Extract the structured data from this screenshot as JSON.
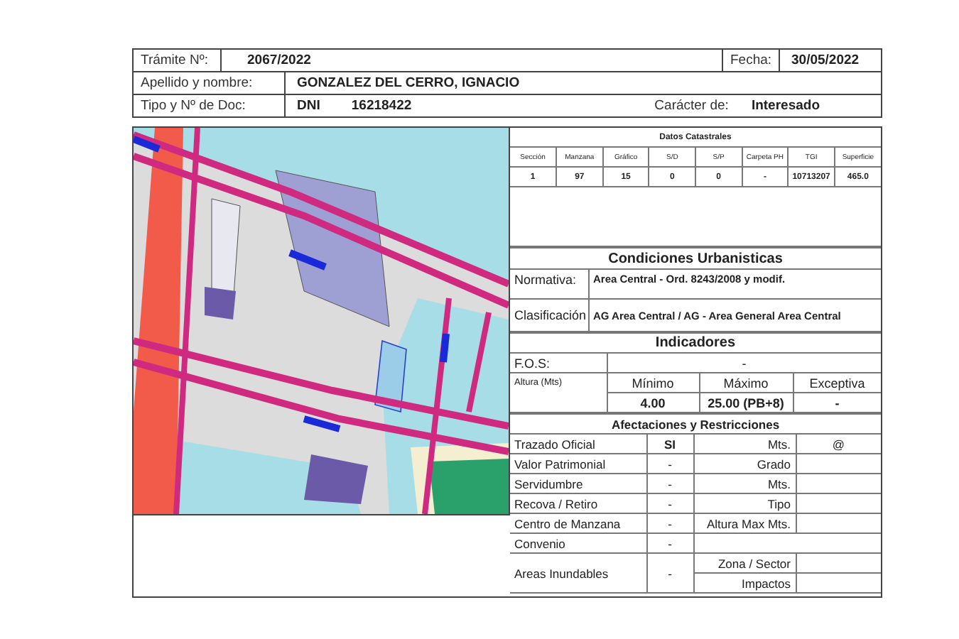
{
  "header": {
    "tramite": {
      "label": "Trámite Nº:",
      "value": "2067/2022"
    },
    "fecha": {
      "label": "Fecha:",
      "value": "30/05/2022"
    },
    "apellido": {
      "label": "Apellido y nombre:",
      "value": "GONZALEZ DEL CERRO, IGNACIO"
    },
    "documento": {
      "label": "Tipo y Nº de Doc:",
      "tipo": "DNI",
      "numero": "16218422"
    },
    "caracter": {
      "label": "Carácter de:",
      "value": "Interesado"
    }
  },
  "catastro": {
    "title": "Datos Catastrales",
    "columns": [
      "Sección",
      "Manzana",
      "Gráfico",
      "S/D",
      "S/P",
      "Carpeta PH",
      "TGI",
      "Superficie"
    ],
    "values": [
      "1",
      "97",
      "15",
      "0",
      "0",
      "-",
      "10713207",
      "465.0"
    ]
  },
  "condiciones": {
    "title": "Condiciones Urbanisticas",
    "rows": [
      {
        "label": "Normativa:",
        "value": "Area Central - Ord. 8243/2008 y modif."
      },
      {
        "label": "Clasificación",
        "value": "AG Area Central / AG - Area General Area Central"
      }
    ]
  },
  "indicadores": {
    "title": "Indicadores",
    "fos": {
      "label": "F.O.S:",
      "value": "-"
    },
    "altura": {
      "label": "Altura (Mts)",
      "columns": [
        "Mínimo",
        "Máximo",
        "Exceptiva"
      ],
      "values": [
        "4.00",
        "25.00 (PB+8)",
        "-"
      ]
    }
  },
  "afectaciones": {
    "title": "Afectaciones y Restricciones",
    "rows": [
      {
        "label": "Trazado Oficial",
        "value": "SI",
        "details": [
          {
            "label": "Mts.",
            "value": "@"
          }
        ]
      },
      {
        "label": "Valor Patrimonial",
        "value": "-",
        "details": [
          {
            "label": "Grado"
          }
        ]
      },
      {
        "label": "Servidumbre",
        "value": "-",
        "details": [
          {
            "label": "Mts."
          }
        ]
      },
      {
        "label": "Recova / Retiro",
        "value": "-",
        "details": [
          {
            "label": "Tipo"
          }
        ]
      },
      {
        "label": "Centro de Manzana",
        "value": "-",
        "details": [
          {
            "label": "Altura Max Mts."
          }
        ]
      },
      {
        "label": "Convenio",
        "value": "-",
        "details": []
      },
      {
        "label": "Areas Inundables",
        "value": "-",
        "details": [
          {
            "label": "Zona / Sector"
          },
          {
            "label": "Impactos"
          }
        ]
      }
    ]
  }
}
